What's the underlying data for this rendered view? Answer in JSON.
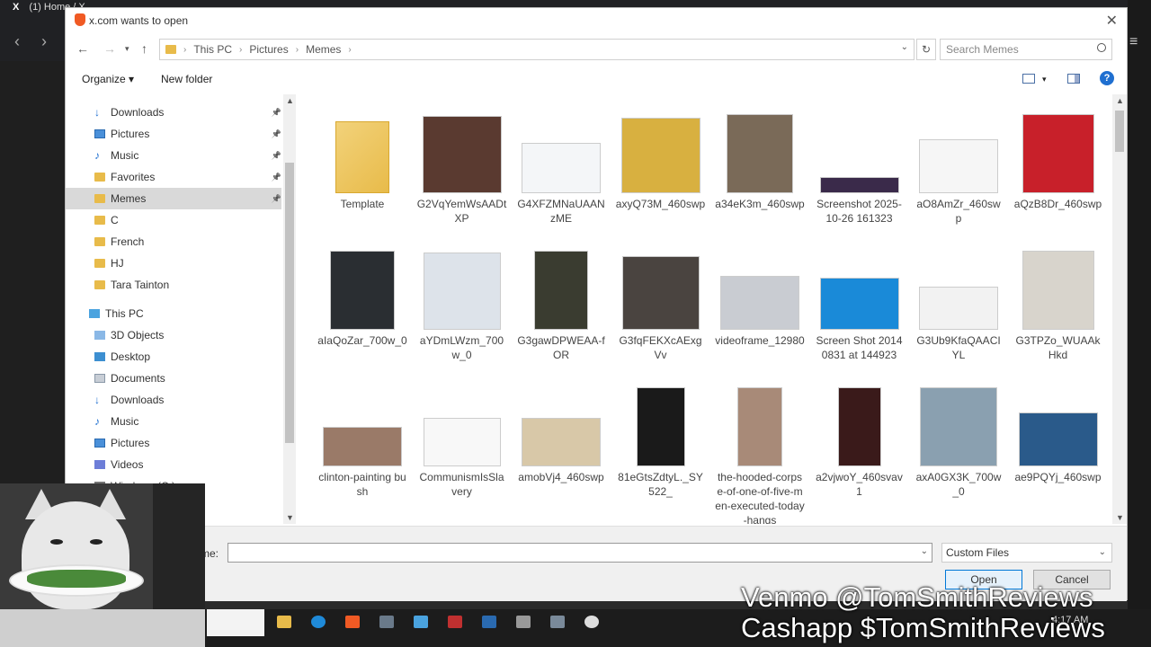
{
  "browser": {
    "tab_title": "(1) Home / X",
    "tab_logo": "X"
  },
  "dialog": {
    "title": "x.com wants to open",
    "breadcrumb": [
      "This PC",
      "Pictures",
      "Memes"
    ],
    "search_placeholder": "Search Memes",
    "toolbar": {
      "organize": "Organize",
      "new_folder": "New folder"
    },
    "nav_items": [
      {
        "label": "Downloads",
        "icon": "download-icon",
        "pinned": true
      },
      {
        "label": "Pictures",
        "icon": "pictures-icon",
        "pinned": true
      },
      {
        "label": "Music",
        "icon": "music-icon",
        "pinned": true
      },
      {
        "label": "Favorites",
        "icon": "folder-icon",
        "pinned": true
      },
      {
        "label": "Memes",
        "icon": "folder-icon",
        "pinned": true,
        "selected": true
      },
      {
        "label": "C",
        "icon": "folder-icon"
      },
      {
        "label": "French",
        "icon": "folder-icon"
      },
      {
        "label": "HJ",
        "icon": "folder-icon"
      },
      {
        "label": "Tara Tainton",
        "icon": "folder-icon"
      },
      {
        "label": "This PC",
        "icon": "pc-icon"
      },
      {
        "label": "3D Objects",
        "icon": "3d-objects-icon"
      },
      {
        "label": "Desktop",
        "icon": "desktop-icon"
      },
      {
        "label": "Documents",
        "icon": "documents-icon"
      },
      {
        "label": "Downloads",
        "icon": "download-icon"
      },
      {
        "label": "Music",
        "icon": "music-icon"
      },
      {
        "label": "Pictures",
        "icon": "pictures-icon"
      },
      {
        "label": "Videos",
        "icon": "videos-icon"
      },
      {
        "label": "Windows (C:)",
        "icon": "drive-icon"
      }
    ],
    "files": [
      {
        "name": "Template",
        "kind": "folder"
      },
      {
        "name": "G2VqYemWsAADtXP",
        "color": "#5a3a30"
      },
      {
        "name": "G4XFZMNaUAANzME",
        "color": "#f4f6f8"
      },
      {
        "name": "axyQ73M_460swp",
        "color": "#d8b040"
      },
      {
        "name": "a34eK3m_460swp",
        "color": "#7a6a58"
      },
      {
        "name": "Screenshot 2025-10-26 161323",
        "color": "#3a2a4a"
      },
      {
        "name": "aO8AmZr_460swp",
        "color": "#f6f6f6"
      },
      {
        "name": "aQzB8Dr_460swp",
        "color": "#c8202a"
      },
      {
        "name": "aIaQoZar_700w_0",
        "color": "#2a2e32"
      },
      {
        "name": "aYDmLWzm_700w_0",
        "color": "#dde3ea"
      },
      {
        "name": "G3gawDPWEAA-fOR",
        "color": "#3a3c30"
      },
      {
        "name": "G3fqFEKXcAExgVv",
        "color": "#4a4440"
      },
      {
        "name": "videoframe_12980",
        "color": "#c9ccd2"
      },
      {
        "name": "Screen Shot 20140831 at 144923",
        "color": "#1a8ad8"
      },
      {
        "name": "G3Ub9KfaQAACIYL",
        "color": "#f2f2f2"
      },
      {
        "name": "G3TPZo_WUAAkHkd",
        "color": "#d8d4cc"
      },
      {
        "name": "clinton-painting bush",
        "color": "#9a7a68"
      },
      {
        "name": "CommunismIsSlavery",
        "color": "#f8f8f8"
      },
      {
        "name": "amobVj4_460swp",
        "color": "#d8c8a8"
      },
      {
        "name": "81eGtsZdtyL._SY522_",
        "color": "#1a1a1a"
      },
      {
        "name": "the-hooded-corpse-of-one-of-five-men-executed-today-hangs",
        "color": "#a88a78"
      },
      {
        "name": "a2vjwoY_460svav1",
        "color": "#3a1a1a"
      },
      {
        "name": "axA0GX3K_700w_0",
        "color": "#8aa0b0"
      },
      {
        "name": "ae9PQYj_460swp",
        "color": "#2a5a8a"
      }
    ],
    "filename_label": "me:",
    "filename_value": "",
    "filetype": "Custom Files",
    "open_button": "Open",
    "cancel_button": "Cancel"
  },
  "taskbar": {
    "clock": "4:17 AM"
  },
  "watermark": {
    "line1": "Venmo @TomSmithReviews",
    "line2": "Cashapp $TomSmithReviews"
  }
}
